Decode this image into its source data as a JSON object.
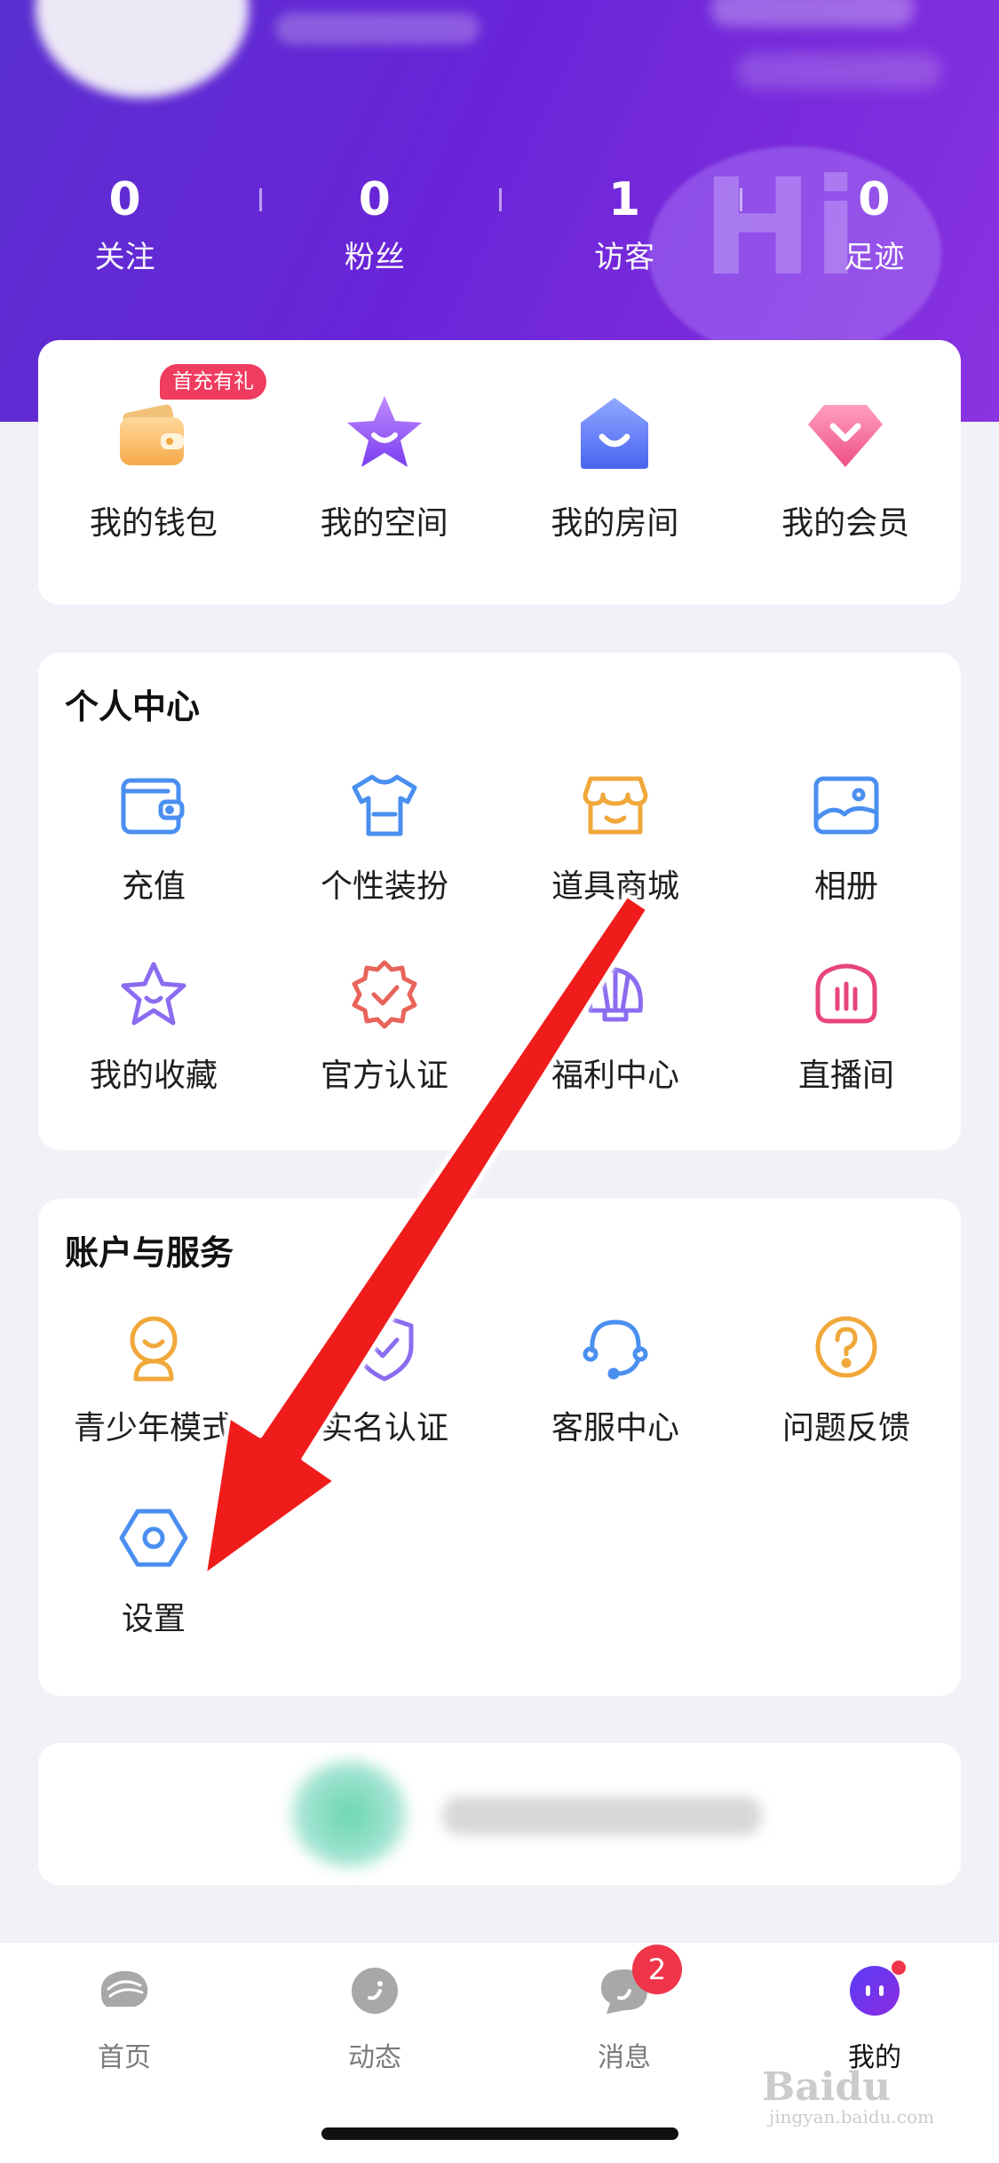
{
  "stats": [
    {
      "value": "0",
      "label": "关注"
    },
    {
      "value": "0",
      "label": "粉丝"
    },
    {
      "value": "1",
      "label": "访客"
    },
    {
      "value": "0",
      "label": "足迹"
    }
  ],
  "quick": {
    "badge": "首充有礼",
    "items": [
      {
        "label": "我的钱包",
        "icon": "wallet-icon"
      },
      {
        "label": "我的空间",
        "icon": "star-space-icon"
      },
      {
        "label": "我的房间",
        "icon": "room-icon"
      },
      {
        "label": "我的会员",
        "icon": "diamond-icon"
      }
    ]
  },
  "personal_center": {
    "title": "个人中心",
    "items": [
      {
        "label": "充值",
        "icon": "recharge-wallet-icon"
      },
      {
        "label": "个性装扮",
        "icon": "tshirt-icon"
      },
      {
        "label": "道具商城",
        "icon": "shop-icon"
      },
      {
        "label": "相册",
        "icon": "album-icon"
      },
      {
        "label": "我的收藏",
        "icon": "star-icon"
      },
      {
        "label": "官方认证",
        "icon": "certified-badge-icon"
      },
      {
        "label": "福利中心",
        "icon": "shell-icon"
      },
      {
        "label": "直播间",
        "icon": "live-room-icon"
      }
    ]
  },
  "account_services": {
    "title": "账户与服务",
    "items": [
      {
        "label": "青少年模式",
        "icon": "teen-mode-icon"
      },
      {
        "label": "实名认证",
        "icon": "shield-check-icon"
      },
      {
        "label": "客服中心",
        "icon": "headset-icon"
      },
      {
        "label": "问题反馈",
        "icon": "question-icon"
      },
      {
        "label": "设置",
        "icon": "settings-hex-icon"
      }
    ]
  },
  "tabbar": {
    "items": [
      {
        "label": "首页",
        "icon": "home-shell-icon"
      },
      {
        "label": "动态",
        "icon": "moments-icon"
      },
      {
        "label": "消息",
        "icon": "message-icon"
      },
      {
        "label": "我的",
        "icon": "profile-face-icon"
      }
    ],
    "message_badge": "2"
  },
  "watermark": {
    "brand": "Baidu",
    "sub": "jingyan.baidu.com"
  },
  "colors": {
    "header_start": "#5a2fd0",
    "header_end": "#8a33e0",
    "icon_blue": "#4a8ff0",
    "icon_orange": "#f0a83a",
    "icon_purple": "#8b6cf0",
    "icon_pink": "#e8457a",
    "badge_red": "#f0344a",
    "arrow_red": "#f01e1e"
  }
}
